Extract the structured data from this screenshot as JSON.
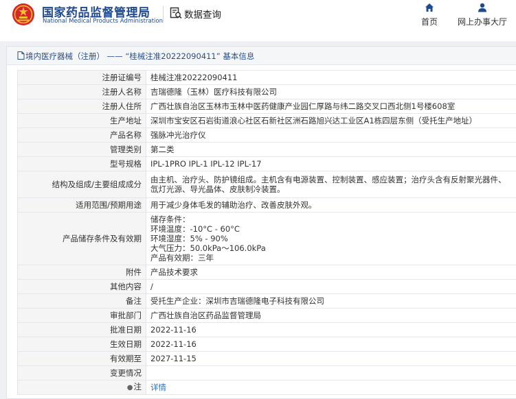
{
  "header": {
    "brand_cn": "国家药品监督管理局",
    "brand_en": "National Medical Products Administration",
    "data_query": "数据查询",
    "nav_home": "首页",
    "nav_office": "网上办事大厅",
    "colors": {
      "brand": "#1f4a8f",
      "emblem_red": "#d8262c",
      "emblem_gold": "#f2c12e",
      "link": "#2b6fc2"
    }
  },
  "breadcrumb": {
    "category": "境内医疗器械（注册）",
    "separator": " —— ",
    "record": "“桂械注准20222090411”",
    "suffix": " 基本信息"
  },
  "fields": {
    "reg_no": {
      "label": "注册证编号",
      "value": "桂械注准20222090411"
    },
    "registrant": {
      "label": "注册人名称",
      "value": "吉瑞德隆（玉林）医疗科技有限公司"
    },
    "registrant_address": {
      "label": "注册人住所",
      "value": "广西壮族自治区玉林市玉林中医药健康产业园仁厚路与纬二路交叉口西北侧1号楼608室"
    },
    "production_address": {
      "label": "生产地址",
      "value": "深圳市宝安区石岩街道浪心社区石新社区洲石路旭兴达工业区A1栋四层东侧（受托生产地址）"
    },
    "product_name": {
      "label": "产品名称",
      "value": "强脉冲光治疗仪"
    },
    "management_class": {
      "label": "管理类别",
      "value": "第二类"
    },
    "model_spec": {
      "label": "型号规格",
      "value": "IPL-1PRO IPL-1 IPL-12 IPL-17"
    },
    "structure": {
      "label": "结构及组成/主要组成成分",
      "value": "由主机、治疗头、防护镜组成。主机含有电源装置、控制装置、感应装置；治疗头含有反射聚光器件、氙灯光源、导光晶体、皮肤制冷装置。"
    },
    "intended_use": {
      "label": "适用范围/预期用途",
      "value": "用于减少身体毛发的辅助治疗、改善皮肤外观。"
    },
    "storage": {
      "label": "产品储存条件及有效期",
      "lines": [
        "储存条件：",
        "环境温度：-10°C - 60°C",
        "环境湿度：5% - 90%",
        "大气压力：50.0kPa～106.0kPa",
        "产品有效期：三年"
      ]
    },
    "attachments": {
      "label": "附件",
      "value": "产品技术要求"
    },
    "other": {
      "label": "其他内容",
      "value": "/"
    },
    "remarks": {
      "label": "备注",
      "value": "受托生产企业：深圳市吉瑞德隆电子科技有限公司"
    },
    "approval_dept": {
      "label": "审批部门",
      "value": "广西壮族自治区药品监督管理局"
    },
    "approval_date": {
      "label": "批准日期",
      "value": "2022-11-16"
    },
    "effective_date": {
      "label": "生效日期",
      "value": "2022-11-16"
    },
    "expiry_date": {
      "label": "有效期至",
      "value": "2027-11-15"
    },
    "change_status": {
      "label": "变更情况",
      "value": ""
    },
    "note": {
      "label": "注",
      "link": "详情"
    }
  }
}
